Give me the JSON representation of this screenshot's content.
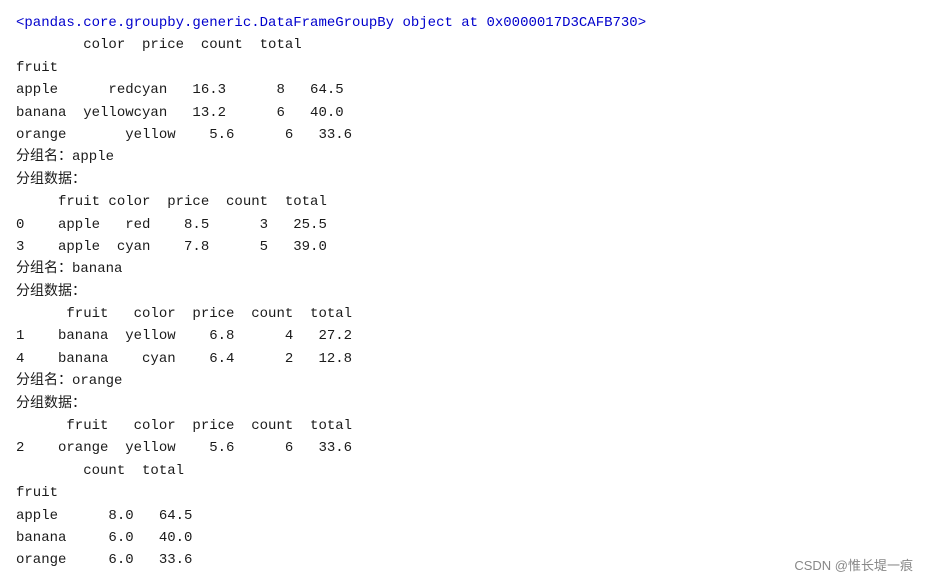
{
  "content": {
    "lines": [
      {
        "text": "<pandas.core.groupby.generic.DataFrameGroupBy object at 0x0000017D3CAFB730>",
        "color": "blue"
      },
      {
        "text": "        color  price  count  total",
        "color": "normal"
      },
      {
        "text": "fruit",
        "color": "normal"
      },
      {
        "text": "apple      redcyan   16.3      8   64.5",
        "color": "normal"
      },
      {
        "text": "banana  yellowcyan   13.2      6   40.0",
        "color": "normal"
      },
      {
        "text": "orange       yellow    5.6      6   33.6",
        "color": "normal"
      },
      {
        "text": "分组名：apple",
        "color": "normal"
      },
      {
        "text": "分组数据：",
        "color": "normal"
      },
      {
        "text": "     fruit color  price  count  total",
        "color": "normal"
      },
      {
        "text": "0    apple   red    8.5      3   25.5",
        "color": "normal"
      },
      {
        "text": "3    apple  cyan    7.8      5   39.0",
        "color": "normal"
      },
      {
        "text": "分组名：banana",
        "color": "normal"
      },
      {
        "text": "分组数据：",
        "color": "normal"
      },
      {
        "text": "      fruit   color  price  count  total",
        "color": "normal"
      },
      {
        "text": "1    banana  yellow    6.8      4   27.2",
        "color": "normal"
      },
      {
        "text": "4    banana    cyan    6.4      2   12.8",
        "color": "normal"
      },
      {
        "text": "分组名：orange",
        "color": "normal"
      },
      {
        "text": "分组数据：",
        "color": "normal"
      },
      {
        "text": "      fruit   color  price  count  total",
        "color": "normal"
      },
      {
        "text": "2    orange  yellow    5.6      6   33.6",
        "color": "normal"
      },
      {
        "text": "        count  total",
        "color": "normal"
      },
      {
        "text": "fruit",
        "color": "normal"
      },
      {
        "text": "apple      8.0   64.5",
        "color": "normal"
      },
      {
        "text": "banana     6.0   40.0",
        "color": "normal"
      },
      {
        "text": "orange     6.0   33.6",
        "color": "normal"
      }
    ],
    "watermark": "CSDN @惟长堤一痕"
  }
}
